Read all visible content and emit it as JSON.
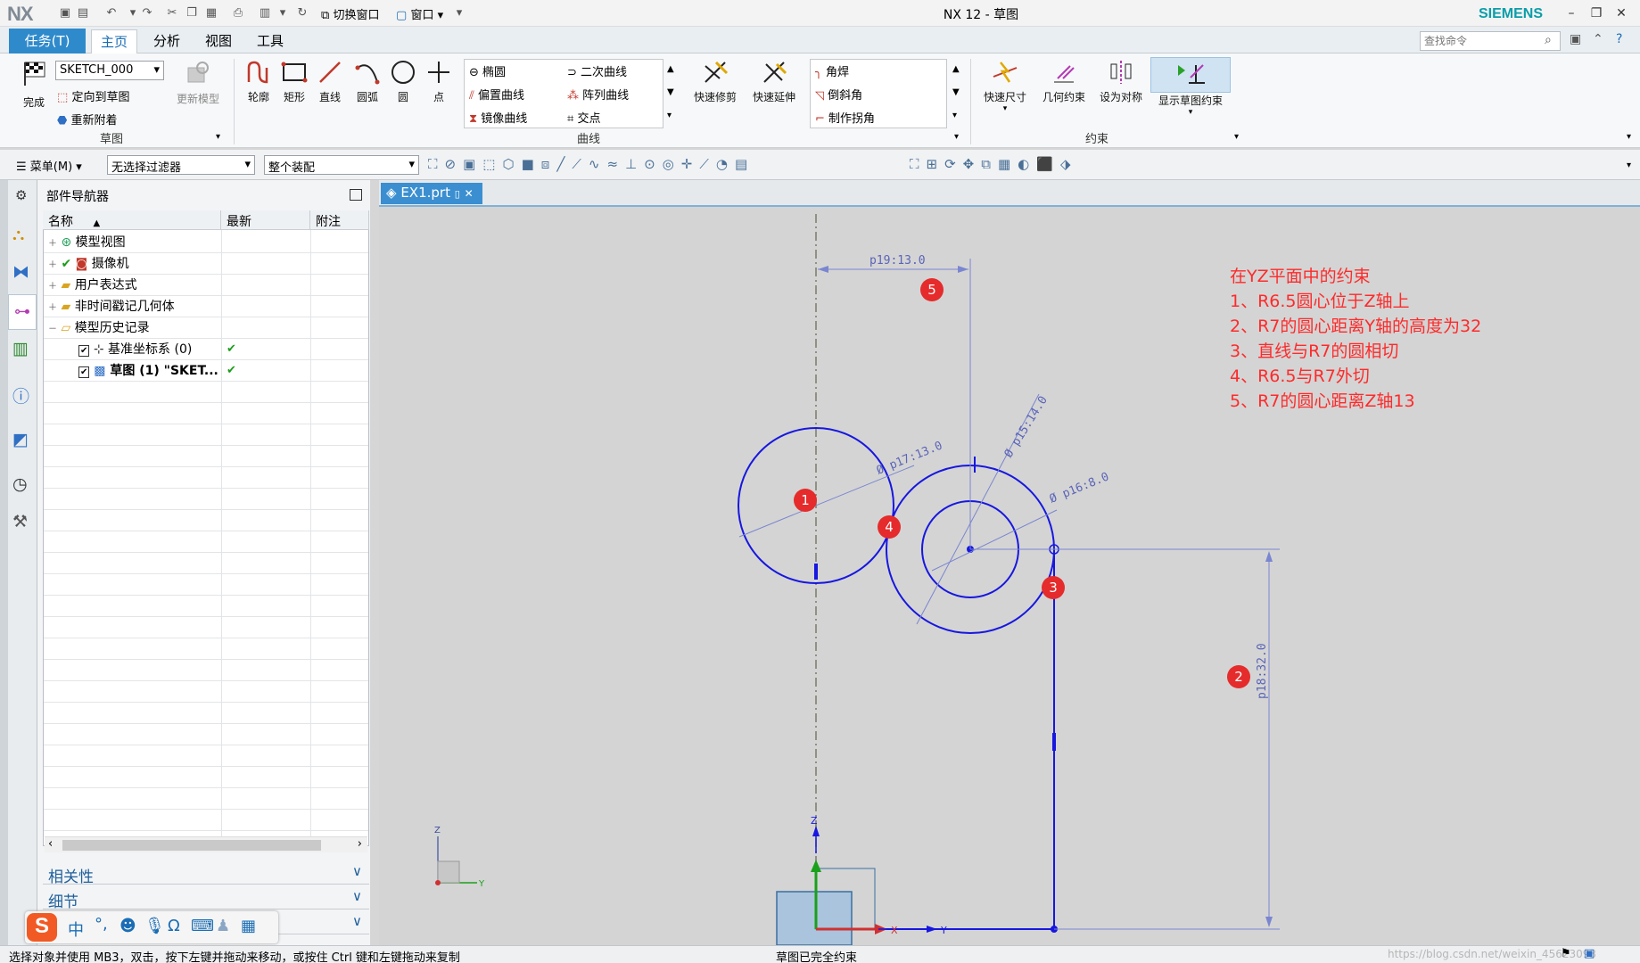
{
  "titlebar": {
    "logo": "NX",
    "window_title": "NX 12 - 草图",
    "brand": "SIEMENS",
    "switch_window": "切换窗口",
    "window_menu": "窗口"
  },
  "menubar": {
    "task": "任务(T)",
    "tabs": [
      "主页",
      "分析",
      "视图",
      "工具"
    ],
    "search_placeholder": "查找命令"
  },
  "ribbon": {
    "sketch_group": {
      "finish": "完成",
      "sketch_name": "SKETCH_000",
      "orient": "定向到草图",
      "reattach": "重新附着",
      "update_model": "更新模型",
      "title": "草图"
    },
    "curve_group": {
      "profile": "轮廓",
      "rectangle": "矩形",
      "line": "直线",
      "arc": "圆弧",
      "circle": "圆",
      "point": "点",
      "ellipse": "椭圆",
      "offset": "偏置曲线",
      "mirror": "镜像曲线",
      "conic": "二次曲线",
      "pattern": "阵列曲线",
      "intersect": "交点",
      "quick_trim": "快速修剪",
      "quick_extend": "快速延伸",
      "fillet": "角焊",
      "chamfer": "倒斜角",
      "make_corner": "制作拐角",
      "title": "曲线"
    },
    "constraint_group": {
      "rapid_dim": "快速尺寸",
      "geo_constraint": "几何约束",
      "make_symmetric": "设为对称",
      "show_constraints": "显示草图约束",
      "title": "约束"
    }
  },
  "toolbar2": {
    "menu": "菜单(M)",
    "filter": "无选择过滤器",
    "scope": "整个装配"
  },
  "navigator": {
    "title": "部件导航器",
    "columns": [
      "名称",
      "最新",
      "附注"
    ],
    "rows": [
      {
        "label": "模型视图"
      },
      {
        "label": "摄像机"
      },
      {
        "label": "用户表达式"
      },
      {
        "label": "非时间戳记几何体"
      },
      {
        "label": "模型历史记录"
      },
      {
        "label": "基准坐标系 (0)"
      },
      {
        "label": "草图 (1) \"SKET..."
      }
    ],
    "accordions": [
      "相关性",
      "细节",
      ""
    ]
  },
  "canvas": {
    "file_tab": "EX1.prt",
    "annotations": [
      "在YZ平面中的约束",
      "1、R6.5圆心位于Z轴上",
      "2、R7的圆心距离Y轴的高度为32",
      "3、直线与R7的圆相切",
      "4、R6.5与R7外切",
      "5、R7的圆心距离Z轴13"
    ],
    "dims": {
      "d1": "p19:13.0",
      "d2": "Ø p17:13.0",
      "d3": "Ø p15:14.0",
      "d4": "Ø p16:8.0",
      "d5": "p18:32.0"
    },
    "badges": [
      "1",
      "2",
      "3",
      "4",
      "5"
    ],
    "axis": {
      "z": "Z",
      "y": "Y",
      "x": "X"
    }
  },
  "statusbar": {
    "hint": "选择对象并使用 MB3，双击，按下左键并拖动来移动，或按住 Ctrl 键和左键拖动来复制",
    "status": "草图已完全约束",
    "watermark": "https://blog.csdn.net/weixin_45623093"
  },
  "ime": {
    "cn": "中"
  }
}
